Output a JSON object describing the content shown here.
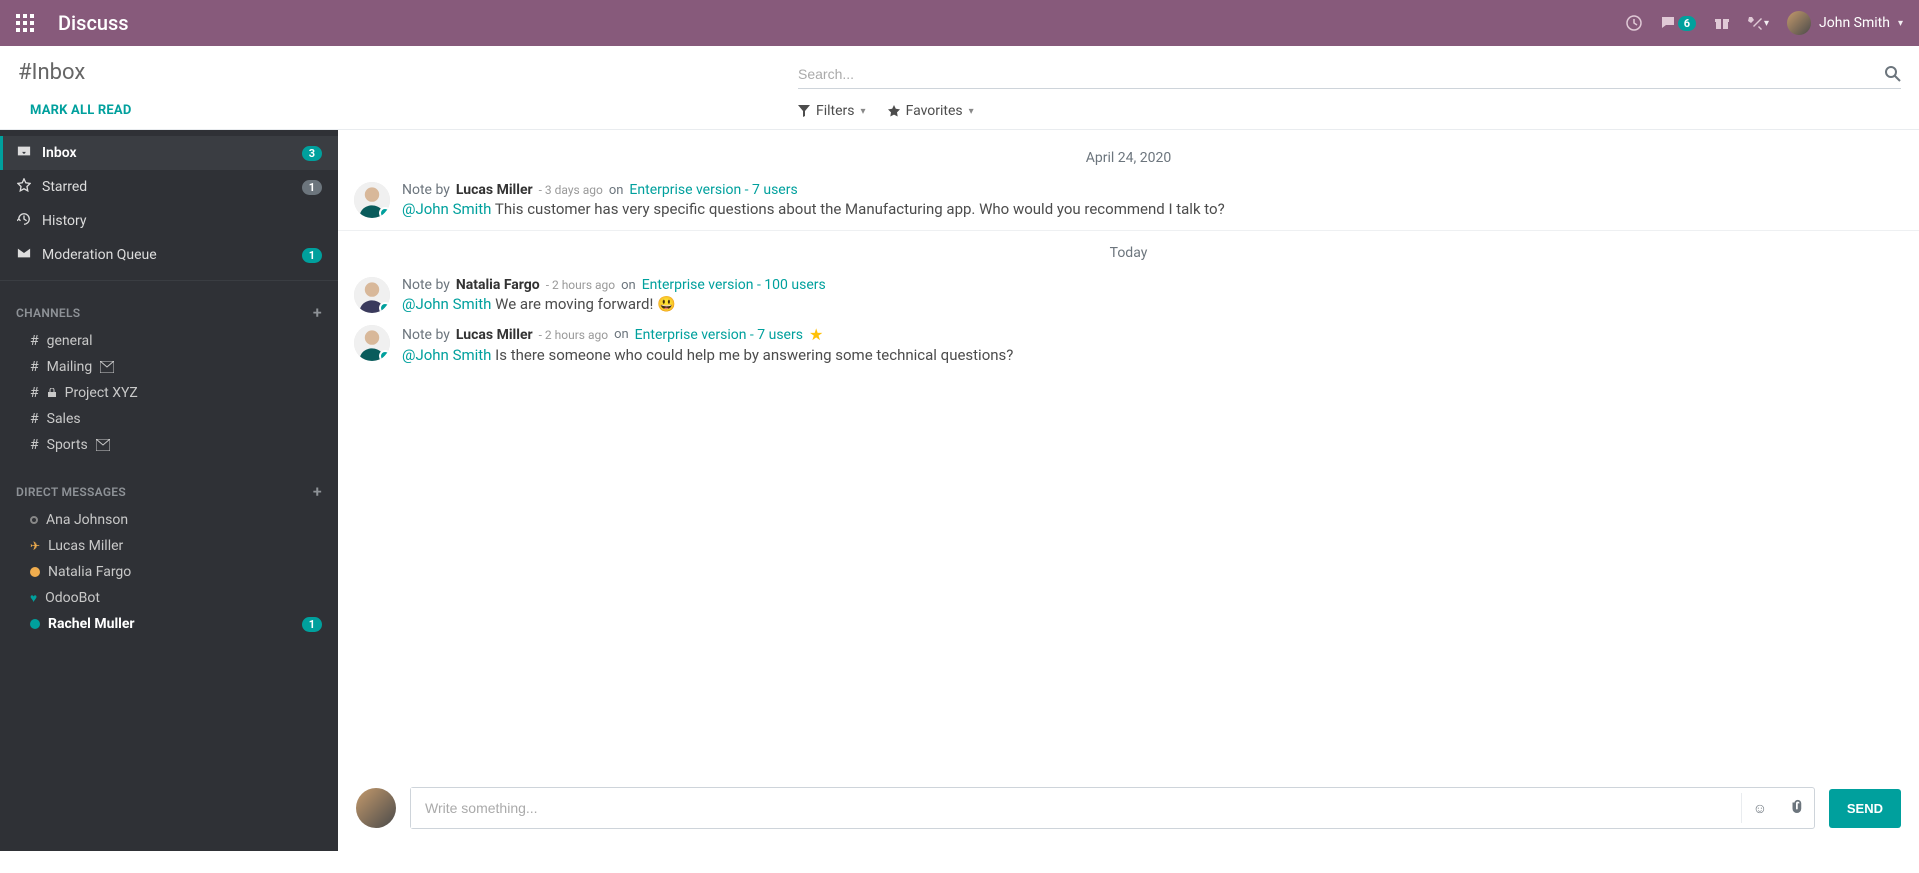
{
  "topbar": {
    "app_title": "Discuss",
    "message_badge": "6",
    "user_name": "John Smith"
  },
  "header": {
    "title": "#Inbox",
    "mark_all_read": "MARK ALL READ",
    "search_placeholder": "Search...",
    "filters_label": "Filters",
    "favorites_label": "Favorites"
  },
  "sidebar": {
    "mailboxes": [
      {
        "icon": "inbox",
        "label": "Inbox",
        "badge": "3",
        "badge_style": "teal",
        "active": true
      },
      {
        "icon": "star",
        "label": "Starred",
        "badge": "1",
        "badge_style": "gray"
      },
      {
        "icon": "history",
        "label": "History"
      },
      {
        "icon": "envelope",
        "label": "Moderation Queue",
        "badge": "1",
        "badge_style": "teal"
      }
    ],
    "channels_head": "CHANNELS",
    "channels": [
      {
        "prefix": "#",
        "label": "general"
      },
      {
        "prefix": "#",
        "label": "Mailing",
        "mail": true
      },
      {
        "prefix": "#",
        "label": "Project XYZ",
        "lock": true
      },
      {
        "prefix": "#",
        "label": "Sales"
      },
      {
        "prefix": "#",
        "label": "Sports",
        "mail": true
      }
    ],
    "dm_head": "DIRECT MESSAGES",
    "dms": [
      {
        "status": "offline",
        "label": "Ana Johnson"
      },
      {
        "status": "plane",
        "label": "Lucas Miller"
      },
      {
        "status": "orange",
        "label": "Natalia Fargo"
      },
      {
        "status": "heart",
        "label": "OdooBot"
      },
      {
        "status": "teal",
        "label": "Rachel Muller",
        "bold": true,
        "badge": "1"
      }
    ]
  },
  "chat": {
    "dates": [
      "April 24, 2020",
      "Today"
    ],
    "messages": [
      {
        "date_idx": 0,
        "note_by": "Note by",
        "author": "Lucas Miller",
        "meta": "- 3 days ago",
        "on": "on",
        "subject": "Enterprise version - 7 users",
        "mention": "@John Smith",
        "body": "This customer has very specific questions about the Manufacturing app. Who would you recommend I talk to?",
        "star": false
      },
      {
        "date_idx": 1,
        "note_by": "Note by",
        "author": "Natalia Fargo",
        "meta": "- 2 hours ago",
        "on": "on",
        "subject": "Enterprise version - 100 users",
        "mention": "@John Smith",
        "body": "We are moving forward! 😃",
        "star": false
      },
      {
        "date_idx": 1,
        "note_by": "Note by",
        "author": "Lucas Miller",
        "meta": "- 2 hours ago",
        "on": "on",
        "subject": "Enterprise version - 7 users",
        "mention": "@John Smith",
        "body": "Is there someone who could help me by answering some technical questions?",
        "star": true
      }
    ],
    "compose_placeholder": "Write something...",
    "send_label": "SEND"
  }
}
